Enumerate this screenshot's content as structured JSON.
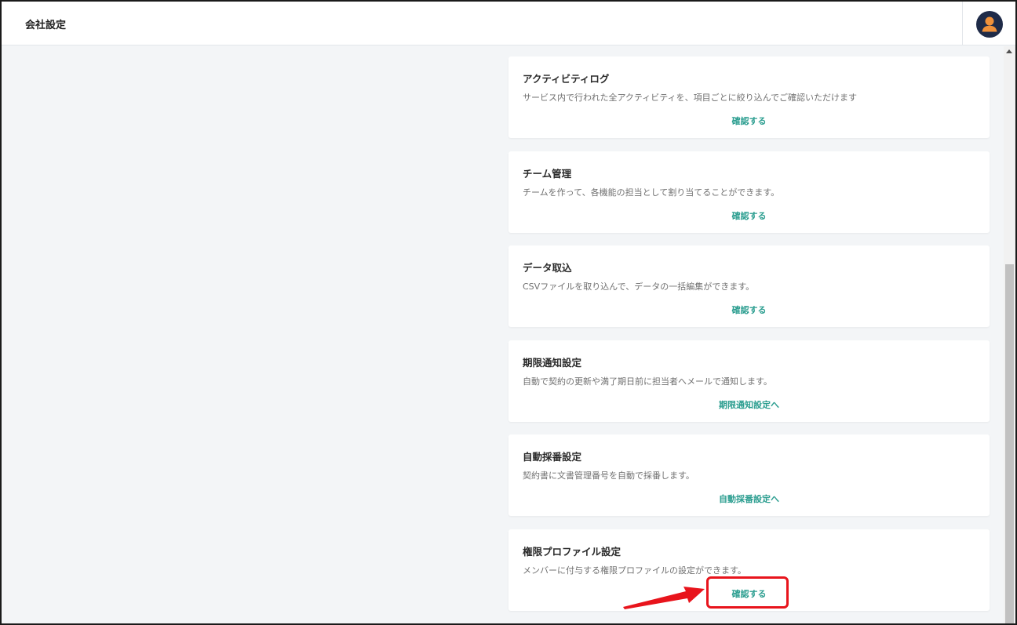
{
  "header": {
    "title": "会社設定"
  },
  "cards": [
    {
      "title": "アクティビティログ",
      "description": "サービス内で行われた全アクティビティを、項目ごとに絞り込んでご確認いただけます",
      "link": "確認する"
    },
    {
      "title": "チーム管理",
      "description": "チームを作って、各機能の担当として割り当てることができます。",
      "link": "確認する"
    },
    {
      "title": "データ取込",
      "description": "CSVファイルを取り込んで、データの一括編集ができます。",
      "link": "確認する"
    },
    {
      "title": "期限通知設定",
      "description": "自動で契約の更新や満了期日前に担当者へメールで通知します。",
      "link": "期限通知設定へ"
    },
    {
      "title": "自動採番設定",
      "description": "契約書に文書管理番号を自動で採番します。",
      "link": "自動採番設定へ"
    },
    {
      "title": "権限プロファイル設定",
      "description": "メンバーに付与する権限プロファイルの設定ができます。",
      "link": "確認する"
    }
  ],
  "colors": {
    "accent_link": "#2a9d8f",
    "annotation": "#e8141c",
    "avatar_bg": "#1f2b48",
    "avatar_fg": "#f0913a"
  },
  "icons": {
    "avatar": "user-avatar-icon",
    "scroll_up": "scroll-up-arrow-icon",
    "annotation_arrow": "red-pointer-arrow-icon"
  }
}
